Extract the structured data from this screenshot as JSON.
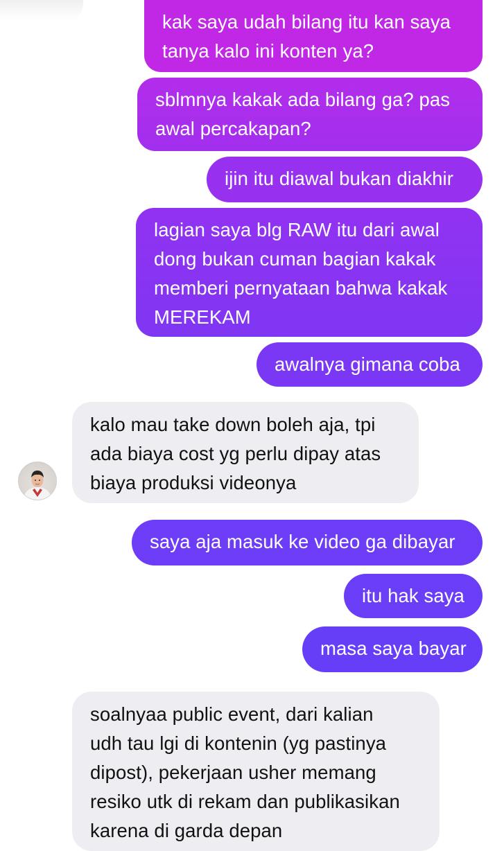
{
  "messages": [
    {
      "sender": "me",
      "lines": [
        "kak saya udah bilang itu kan saya",
        "tanya kalo ini konten ya?"
      ]
    },
    {
      "sender": "me",
      "lines": [
        "sblmnya kakak ada bilang ga? pas",
        "awal percakapan?"
      ]
    },
    {
      "sender": "me",
      "lines": [
        "ijin itu diawal bukan diakhir"
      ]
    },
    {
      "sender": "me",
      "lines": [
        "lagian saya blg RAW itu dari awal",
        "dong bukan cuman bagian kakak",
        "memberi pernyataan bahwa kakak",
        "MEREKAM"
      ]
    },
    {
      "sender": "me",
      "lines": [
        "awalnya gimana coba"
      ]
    },
    {
      "sender": "them",
      "lines": [
        "kalo mau take down boleh aja, tpi",
        "ada biaya cost yg perlu dipay atas",
        "biaya produksi videonya"
      ]
    },
    {
      "sender": "me",
      "lines": [
        "saya aja masuk ke video ga dibayar"
      ]
    },
    {
      "sender": "me",
      "lines": [
        "itu hak saya"
      ]
    },
    {
      "sender": "me",
      "lines": [
        "masa saya bayar"
      ]
    },
    {
      "sender": "them",
      "lines": [
        "soalnyaa public event, dari kalian",
        "udh tau lgi di kontenin (yg pastinya",
        "dipost), pekerjaan usher memang",
        "resiko utk di rekam dan publikasikan",
        "karena di garda depan"
      ]
    }
  ],
  "colors": {
    "outgoing_top": "#c128e6",
    "outgoing_bottom": "#6b3cf6",
    "incoming_bg": "#eeeef2",
    "incoming_text": "#111111"
  },
  "avatar": {
    "icon": "contact-avatar-icon"
  }
}
